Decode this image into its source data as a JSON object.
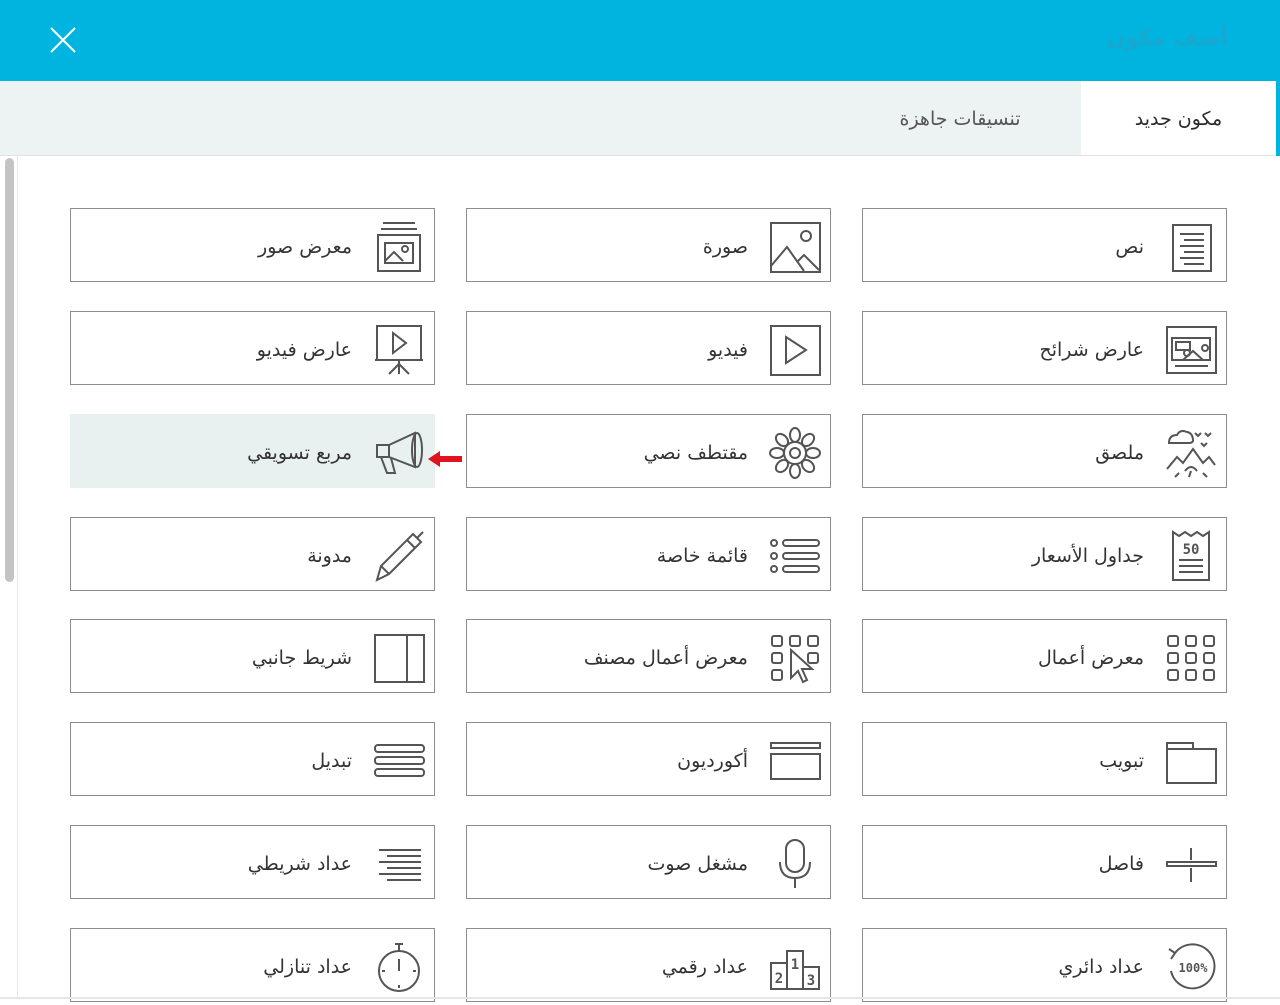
{
  "header": {
    "title": "أضف مكون"
  },
  "tabs": {
    "active": "مكون جديد",
    "inactive": "تنسيقات جاهزة"
  },
  "components": {
    "text": "نص",
    "image": "صورة",
    "gallery": "معرض صور",
    "slider": "عارض شرائح",
    "video": "فيديو",
    "video_viewer": "عارض فيديو",
    "sticker": "ملصق",
    "quote": "مقتطف نصي",
    "marketing_box": "مربع تسويقي",
    "price_tables": "جداول الأسعار",
    "custom_list": "قائمة خاصة",
    "blog": "مدونة",
    "portfolio": "معرض أعمال",
    "filtered_portfolio": "معرض أعمال مصنف",
    "sidebar": "شريط جانبي",
    "tabs": "تبويب",
    "accordion": "أكورديون",
    "toggle": "تبديل",
    "divider": "فاصل",
    "audio": "مشغل صوت",
    "bar_counter": "عداد شريطي",
    "circle_counter": "عداد دائري",
    "number_counter": "عداد رقمي",
    "countdown": "عداد تنازلي"
  },
  "icon_labels": {
    "price": "50",
    "circle": "100%",
    "podium": [
      "2",
      "1",
      "3"
    ]
  },
  "colors": {
    "header": "#00b4e0",
    "tab_bar": "#edf2f2",
    "highlight": "#e8f0f0",
    "pointer_arrow": "#e0141e",
    "card_border": "#8d8d8d"
  }
}
